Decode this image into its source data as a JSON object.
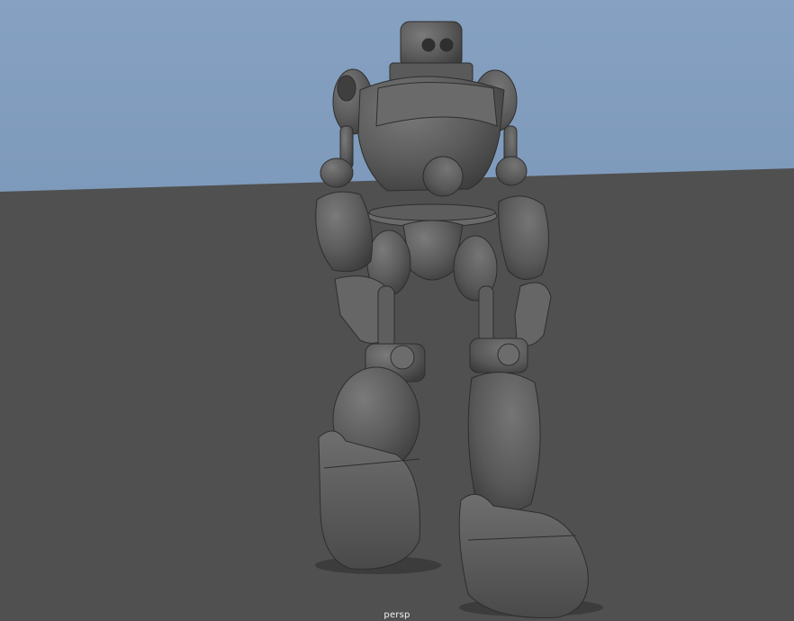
{
  "viewport": {
    "camera_name": "persp",
    "colors": {
      "sky_top": "#7f9bbc",
      "sky_bottom": "#6c8aae",
      "ground": "#505050",
      "model_light": "#6f6f6f",
      "model_mid": "#595959",
      "model_dark": "#353535",
      "wire": "#2b2b2b"
    },
    "objects": [
      {
        "name": "robot-model",
        "icon": "robot-mesh"
      }
    ]
  }
}
